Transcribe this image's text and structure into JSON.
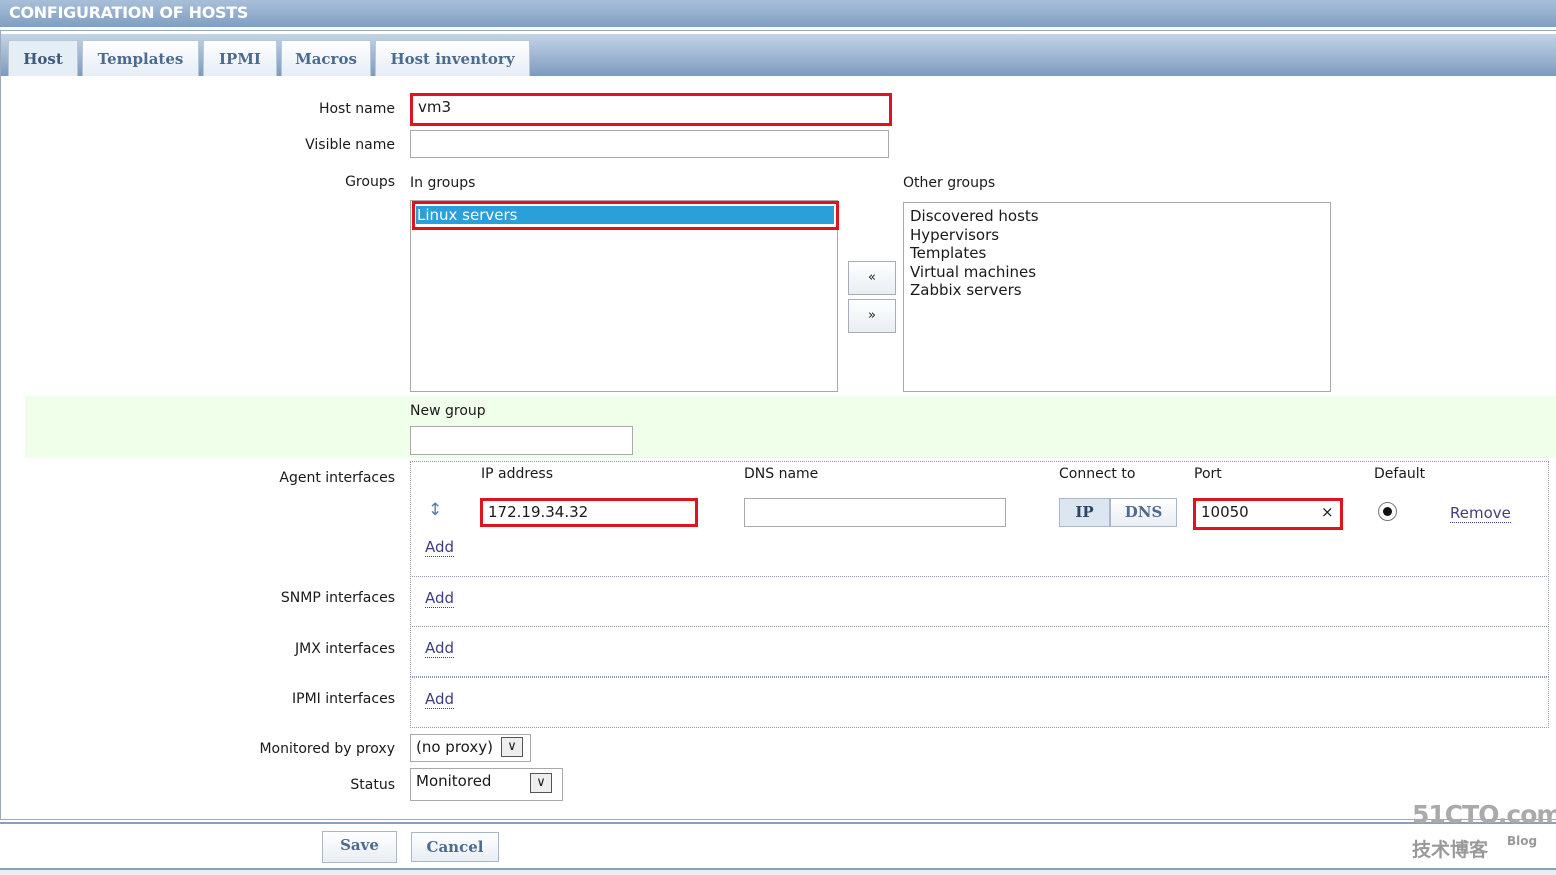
{
  "header": {
    "title": "CONFIGURATION OF HOSTS"
  },
  "tabs": [
    {
      "label": "Host"
    },
    {
      "label": "Templates"
    },
    {
      "label": "IPMI"
    },
    {
      "label": "Macros"
    },
    {
      "label": "Host inventory"
    }
  ],
  "form": {
    "host_name": {
      "label": "Host name",
      "value": "vm3"
    },
    "visible_name": {
      "label": "Visible name",
      "value": ""
    },
    "groups": {
      "label": "Groups",
      "in_label": "In groups",
      "other_label": "Other groups",
      "in_groups": [
        "Linux servers"
      ],
      "other_groups": [
        "Discovered hosts",
        "Hypervisors",
        "Templates",
        "Virtual machines",
        "Zabbix servers"
      ],
      "move_left": "«",
      "move_right": "»"
    },
    "new_group": {
      "label": "New group",
      "value": ""
    },
    "agent": {
      "label": "Agent interfaces",
      "col_ip": "IP address",
      "col_dns": "DNS name",
      "col_connect": "Connect to",
      "col_port": "Port",
      "col_default": "Default",
      "ip": "172.19.34.32",
      "dns": "",
      "connect_ip": "IP",
      "connect_dns": "DNS",
      "port": "10050",
      "clear": "×",
      "remove": "Remove",
      "add": "Add"
    },
    "snmp": {
      "label": "SNMP interfaces",
      "add": "Add"
    },
    "jmx": {
      "label": "JMX interfaces",
      "add": "Add"
    },
    "ipmi": {
      "label": "IPMI interfaces",
      "add": "Add"
    },
    "proxy": {
      "label": "Monitored by proxy",
      "value": "(no proxy)"
    },
    "status": {
      "label": "Status",
      "value": "Monitored"
    }
  },
  "footer": {
    "save": "Save",
    "cancel": "Cancel"
  },
  "watermark": {
    "line1": "51CTO.com",
    "line2": "技术博客",
    "line3": "Blog"
  }
}
